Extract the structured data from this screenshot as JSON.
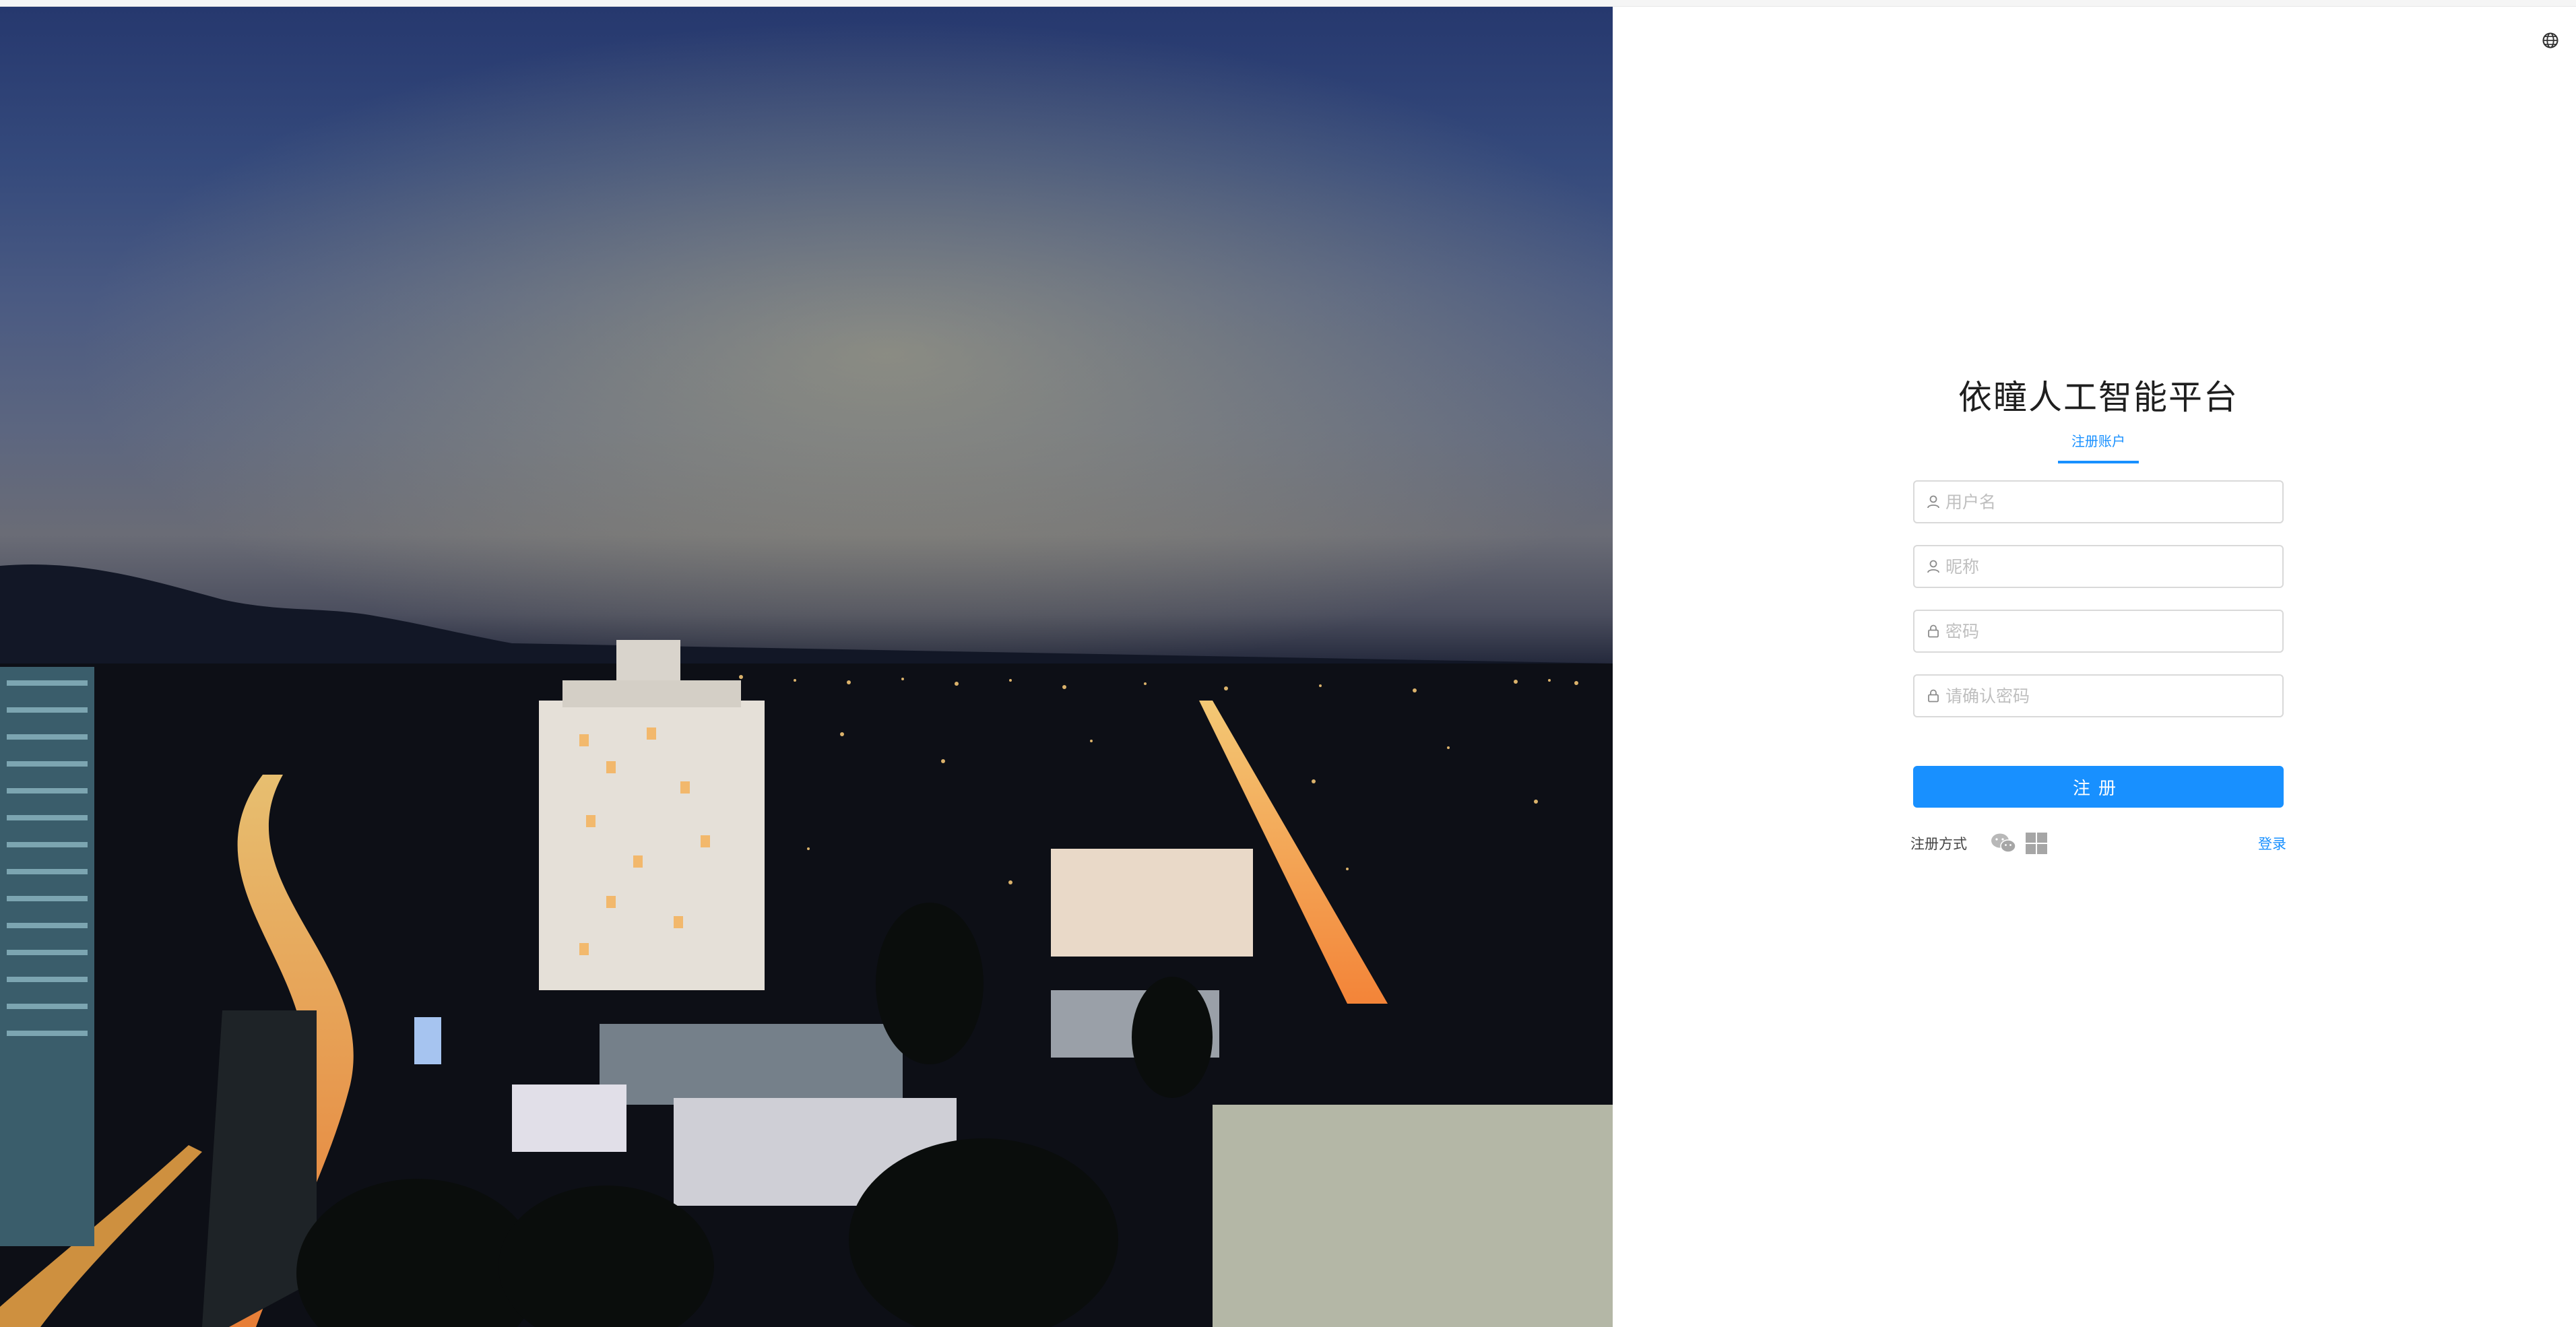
{
  "app": {
    "title": "依瞳人工智能平台"
  },
  "hero": {
    "image_description": "night city"
  },
  "header": {
    "language_icon": "globe-icon"
  },
  "register_form": {
    "tab_label": "注册账户",
    "fields": {
      "username": {
        "placeholder": "用户名",
        "value": "",
        "icon": "user-icon"
      },
      "nickname": {
        "placeholder": "昵称",
        "value": "",
        "icon": "user-icon"
      },
      "password": {
        "placeholder": "密码",
        "value": "",
        "icon": "lock-icon"
      },
      "confirm_password": {
        "placeholder": "请确认密码",
        "value": "",
        "icon": "lock-icon"
      }
    },
    "submit_label": "注册",
    "other_methods_label": "注册方式",
    "other_methods_icons": [
      "wechat-icon",
      "windows-icon"
    ],
    "login_link_label": "登录"
  },
  "colors": {
    "primary": "#1890ff",
    "border": "#d9d9d9",
    "placeholder": "#bfbfbf"
  }
}
